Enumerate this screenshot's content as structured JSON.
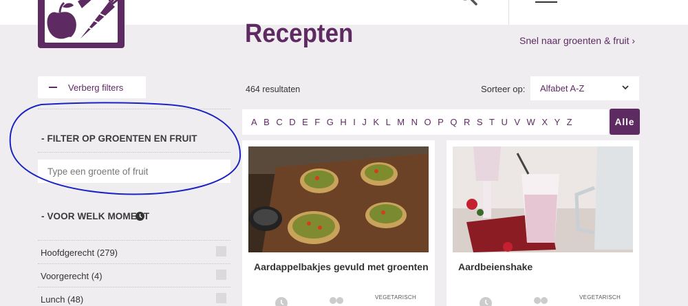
{
  "header": {
    "logo_alt": "",
    "search_icon": "search-icon",
    "menu_icon": "hamburger-icon"
  },
  "page": {
    "title": "Recepten",
    "quick_link": "Snel naar groenten & fruit ›"
  },
  "sidebar": {
    "hide_filters_label": "Verberg filters",
    "veg_filter_heading": "- FILTER OP GROENTEN EN FRUIT",
    "veg_input_placeholder": "Type een groente of fruit",
    "moment_heading": "- VOOR WELK MOMENT",
    "moment_icon": "clock-icon",
    "moments": [
      {
        "label": "Hoofdgerecht (279)"
      },
      {
        "label": "Voorgerecht (4)"
      },
      {
        "label": "Lunch (48)"
      }
    ]
  },
  "results": {
    "count_label": "464 resultaten",
    "sort_label": "Sorteer op:",
    "sort_value": "Alfabet A-Z",
    "letters": [
      "A",
      "B",
      "C",
      "D",
      "E",
      "F",
      "G",
      "H",
      "I",
      "J",
      "K",
      "L",
      "M",
      "N",
      "O",
      "P",
      "Q",
      "R",
      "S",
      "T",
      "U",
      "V",
      "W",
      "X",
      "Y",
      "Z"
    ],
    "all_label": "Alle"
  },
  "cards": [
    {
      "title": "Aardappelbakjes gevuld met groenten",
      "tag": "VEGETARISCH"
    },
    {
      "title": "Aardbeienshake",
      "tag": "VEGETARISCH"
    }
  ],
  "colors": {
    "brand": "#5e2a62",
    "annotation": "#1a23c4",
    "background": "#efedf0"
  }
}
